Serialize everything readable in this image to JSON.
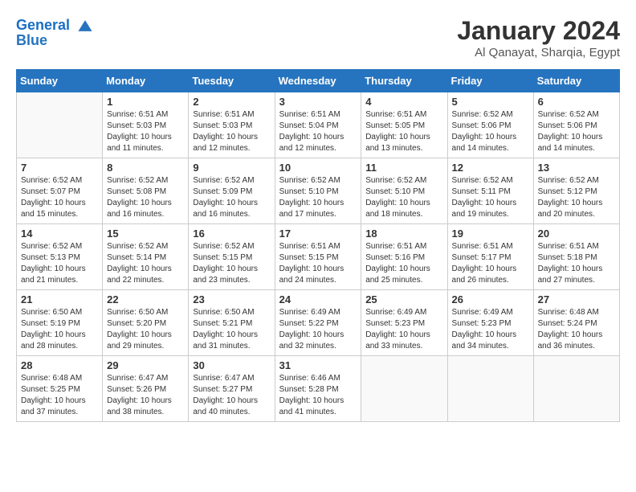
{
  "header": {
    "logo_line1": "General",
    "logo_line2": "Blue",
    "title": "January 2024",
    "subtitle": "Al Qanayat, Sharqia, Egypt"
  },
  "columns": [
    "Sunday",
    "Monday",
    "Tuesday",
    "Wednesday",
    "Thursday",
    "Friday",
    "Saturday"
  ],
  "weeks": [
    [
      {
        "day": "",
        "sunrise": "",
        "sunset": "",
        "daylight": ""
      },
      {
        "day": "1",
        "sunrise": "Sunrise: 6:51 AM",
        "sunset": "Sunset: 5:03 PM",
        "daylight": "Daylight: 10 hours and 11 minutes."
      },
      {
        "day": "2",
        "sunrise": "Sunrise: 6:51 AM",
        "sunset": "Sunset: 5:03 PM",
        "daylight": "Daylight: 10 hours and 12 minutes."
      },
      {
        "day": "3",
        "sunrise": "Sunrise: 6:51 AM",
        "sunset": "Sunset: 5:04 PM",
        "daylight": "Daylight: 10 hours and 12 minutes."
      },
      {
        "day": "4",
        "sunrise": "Sunrise: 6:51 AM",
        "sunset": "Sunset: 5:05 PM",
        "daylight": "Daylight: 10 hours and 13 minutes."
      },
      {
        "day": "5",
        "sunrise": "Sunrise: 6:52 AM",
        "sunset": "Sunset: 5:06 PM",
        "daylight": "Daylight: 10 hours and 14 minutes."
      },
      {
        "day": "6",
        "sunrise": "Sunrise: 6:52 AM",
        "sunset": "Sunset: 5:06 PM",
        "daylight": "Daylight: 10 hours and 14 minutes."
      }
    ],
    [
      {
        "day": "7",
        "sunrise": "Sunrise: 6:52 AM",
        "sunset": "Sunset: 5:07 PM",
        "daylight": "Daylight: 10 hours and 15 minutes."
      },
      {
        "day": "8",
        "sunrise": "Sunrise: 6:52 AM",
        "sunset": "Sunset: 5:08 PM",
        "daylight": "Daylight: 10 hours and 16 minutes."
      },
      {
        "day": "9",
        "sunrise": "Sunrise: 6:52 AM",
        "sunset": "Sunset: 5:09 PM",
        "daylight": "Daylight: 10 hours and 16 minutes."
      },
      {
        "day": "10",
        "sunrise": "Sunrise: 6:52 AM",
        "sunset": "Sunset: 5:10 PM",
        "daylight": "Daylight: 10 hours and 17 minutes."
      },
      {
        "day": "11",
        "sunrise": "Sunrise: 6:52 AM",
        "sunset": "Sunset: 5:10 PM",
        "daylight": "Daylight: 10 hours and 18 minutes."
      },
      {
        "day": "12",
        "sunrise": "Sunrise: 6:52 AM",
        "sunset": "Sunset: 5:11 PM",
        "daylight": "Daylight: 10 hours and 19 minutes."
      },
      {
        "day": "13",
        "sunrise": "Sunrise: 6:52 AM",
        "sunset": "Sunset: 5:12 PM",
        "daylight": "Daylight: 10 hours and 20 minutes."
      }
    ],
    [
      {
        "day": "14",
        "sunrise": "Sunrise: 6:52 AM",
        "sunset": "Sunset: 5:13 PM",
        "daylight": "Daylight: 10 hours and 21 minutes."
      },
      {
        "day": "15",
        "sunrise": "Sunrise: 6:52 AM",
        "sunset": "Sunset: 5:14 PM",
        "daylight": "Daylight: 10 hours and 22 minutes."
      },
      {
        "day": "16",
        "sunrise": "Sunrise: 6:52 AM",
        "sunset": "Sunset: 5:15 PM",
        "daylight": "Daylight: 10 hours and 23 minutes."
      },
      {
        "day": "17",
        "sunrise": "Sunrise: 6:51 AM",
        "sunset": "Sunset: 5:15 PM",
        "daylight": "Daylight: 10 hours and 24 minutes."
      },
      {
        "day": "18",
        "sunrise": "Sunrise: 6:51 AM",
        "sunset": "Sunset: 5:16 PM",
        "daylight": "Daylight: 10 hours and 25 minutes."
      },
      {
        "day": "19",
        "sunrise": "Sunrise: 6:51 AM",
        "sunset": "Sunset: 5:17 PM",
        "daylight": "Daylight: 10 hours and 26 minutes."
      },
      {
        "day": "20",
        "sunrise": "Sunrise: 6:51 AM",
        "sunset": "Sunset: 5:18 PM",
        "daylight": "Daylight: 10 hours and 27 minutes."
      }
    ],
    [
      {
        "day": "21",
        "sunrise": "Sunrise: 6:50 AM",
        "sunset": "Sunset: 5:19 PM",
        "daylight": "Daylight: 10 hours and 28 minutes."
      },
      {
        "day": "22",
        "sunrise": "Sunrise: 6:50 AM",
        "sunset": "Sunset: 5:20 PM",
        "daylight": "Daylight: 10 hours and 29 minutes."
      },
      {
        "day": "23",
        "sunrise": "Sunrise: 6:50 AM",
        "sunset": "Sunset: 5:21 PM",
        "daylight": "Daylight: 10 hours and 31 minutes."
      },
      {
        "day": "24",
        "sunrise": "Sunrise: 6:49 AM",
        "sunset": "Sunset: 5:22 PM",
        "daylight": "Daylight: 10 hours and 32 minutes."
      },
      {
        "day": "25",
        "sunrise": "Sunrise: 6:49 AM",
        "sunset": "Sunset: 5:23 PM",
        "daylight": "Daylight: 10 hours and 33 minutes."
      },
      {
        "day": "26",
        "sunrise": "Sunrise: 6:49 AM",
        "sunset": "Sunset: 5:23 PM",
        "daylight": "Daylight: 10 hours and 34 minutes."
      },
      {
        "day": "27",
        "sunrise": "Sunrise: 6:48 AM",
        "sunset": "Sunset: 5:24 PM",
        "daylight": "Daylight: 10 hours and 36 minutes."
      }
    ],
    [
      {
        "day": "28",
        "sunrise": "Sunrise: 6:48 AM",
        "sunset": "Sunset: 5:25 PM",
        "daylight": "Daylight: 10 hours and 37 minutes."
      },
      {
        "day": "29",
        "sunrise": "Sunrise: 6:47 AM",
        "sunset": "Sunset: 5:26 PM",
        "daylight": "Daylight: 10 hours and 38 minutes."
      },
      {
        "day": "30",
        "sunrise": "Sunrise: 6:47 AM",
        "sunset": "Sunset: 5:27 PM",
        "daylight": "Daylight: 10 hours and 40 minutes."
      },
      {
        "day": "31",
        "sunrise": "Sunrise: 6:46 AM",
        "sunset": "Sunset: 5:28 PM",
        "daylight": "Daylight: 10 hours and 41 minutes."
      },
      {
        "day": "",
        "sunrise": "",
        "sunset": "",
        "daylight": ""
      },
      {
        "day": "",
        "sunrise": "",
        "sunset": "",
        "daylight": ""
      },
      {
        "day": "",
        "sunrise": "",
        "sunset": "",
        "daylight": ""
      }
    ]
  ]
}
